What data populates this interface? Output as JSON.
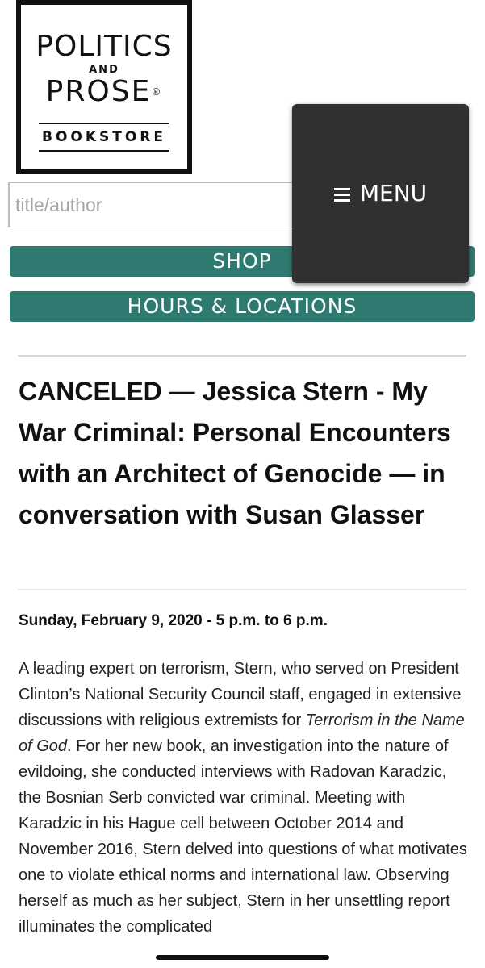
{
  "logo": {
    "line1": "POLITICS",
    "line2": "AND",
    "line3": "PROSE",
    "registered": "®",
    "line4": "BOOKSTORE"
  },
  "search": {
    "placeholder": "title/author",
    "value": ""
  },
  "nav": {
    "shop_label": "SHOP",
    "hours_label": "HOURS & LOCATIONS"
  },
  "menu": {
    "icon": "hamburger-icon",
    "label": "MENU"
  },
  "event": {
    "title": "CANCELED — Jessica Stern - My War Criminal: Personal Encounters with an Architect of Genocide — in conversation with Susan Glasser",
    "date": "Sunday, February 9, 2020 - 5 p.m. to 6 p.m.",
    "description_part1": "A leading expert on terrorism, Stern, who served on President Clinton’s National Security Council staff, engaged in extensive discussions with religious extremists for ",
    "description_italic": "Terrorism in the Name of God",
    "description_part2": ". For her new book, an investigation into the nature of evildoing, she conducted interviews with Radovan Karadzic, the Bosnian Serb convicted war criminal. Meeting with Karadzic in his Hague cell between October 2014 and November 2016, Stern delved into questions of what motivates one to violate ethical norms and international law. Observing herself as much as her subject, Stern in her unsettling report illuminates the complicated"
  },
  "colors": {
    "teal": "#2f7a70",
    "menu_bg": "#303030"
  }
}
